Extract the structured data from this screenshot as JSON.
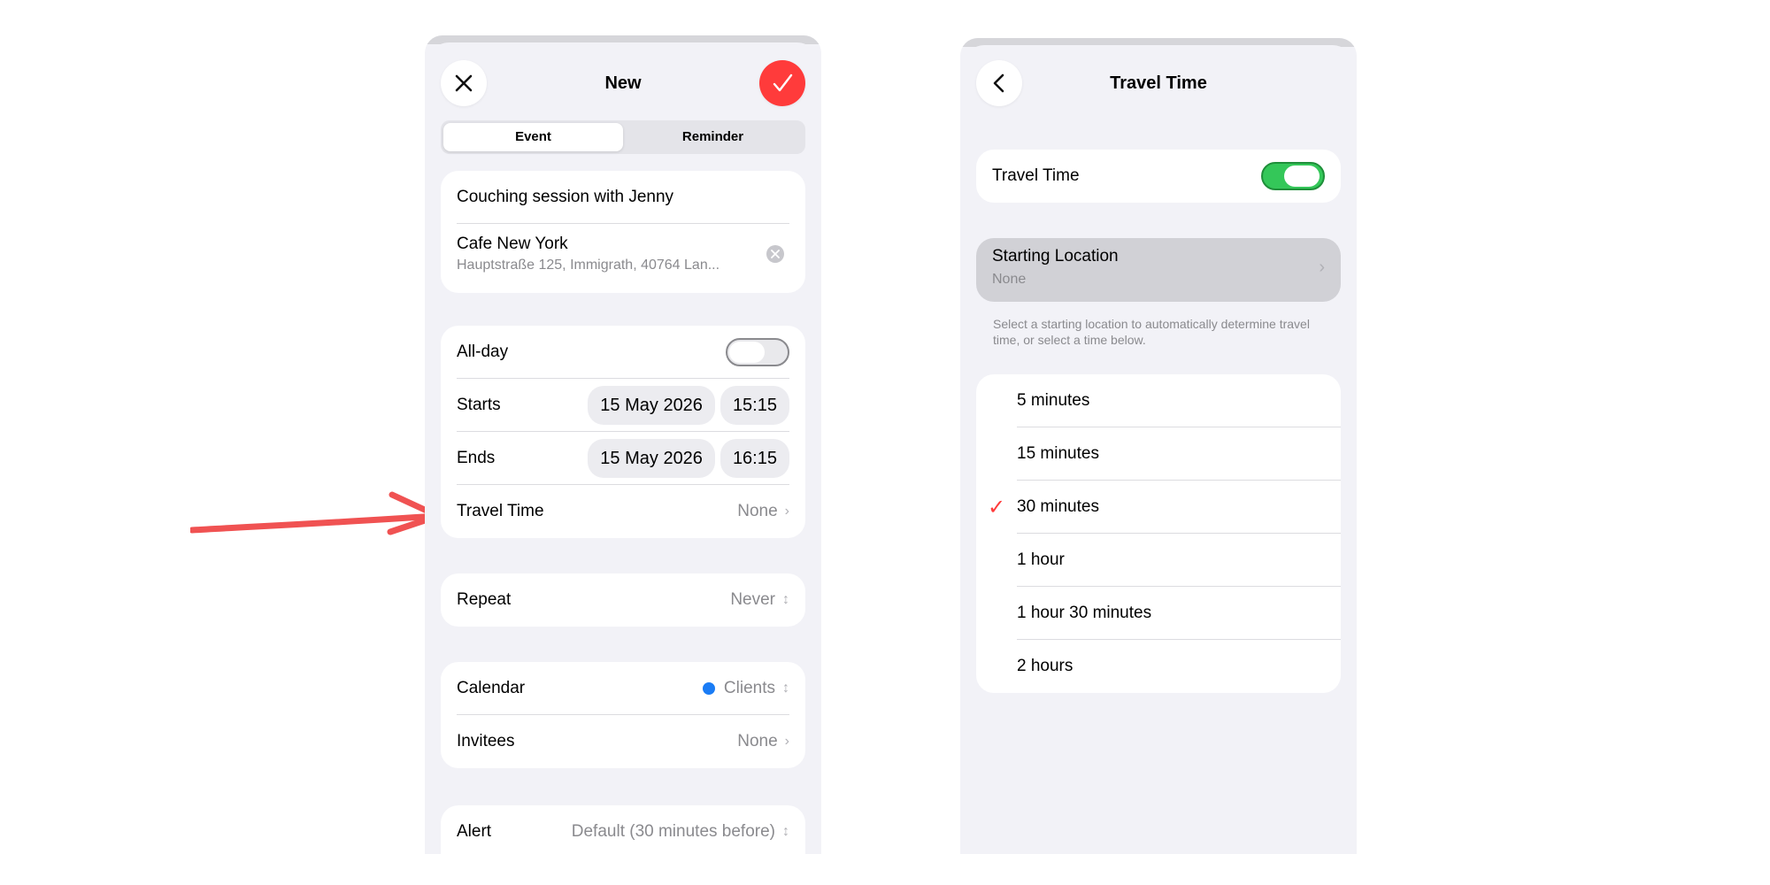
{
  "left": {
    "nav": {
      "title": "New"
    },
    "segments": [
      "Event",
      "Reminder"
    ],
    "event_title": "Couching session with Jenny",
    "location": {
      "name": "Cafe New York",
      "address": "Hauptstraße 125, Immigrath, 40764 Lan..."
    },
    "rows": {
      "allday": {
        "label": "All-day"
      },
      "starts": {
        "label": "Starts",
        "date": "15 May 2026",
        "time": "15:15"
      },
      "ends": {
        "label": "Ends",
        "date": "15 May 2026",
        "time": "16:15"
      },
      "travel": {
        "label": "Travel Time",
        "value": "None"
      },
      "repeat": {
        "label": "Repeat",
        "value": "Never"
      },
      "calendar": {
        "label": "Calendar",
        "value": "Clients"
      },
      "invitees": {
        "label": "Invitees",
        "value": "None"
      },
      "alert": {
        "label": "Alert",
        "value": "Default (30 minutes before)"
      }
    }
  },
  "right": {
    "nav": {
      "title": "Travel Time"
    },
    "toggle_label": "Travel Time",
    "starting_location": {
      "label": "Starting Location",
      "value": "None"
    },
    "hint": "Select a starting location to automatically determine travel time, or select a time below.",
    "options": [
      {
        "label": "5 minutes",
        "selected": false
      },
      {
        "label": "15 minutes",
        "selected": false
      },
      {
        "label": "30 minutes",
        "selected": true
      },
      {
        "label": "1 hour",
        "selected": false
      },
      {
        "label": "1 hour 30 minutes",
        "selected": false
      },
      {
        "label": "2 hours",
        "selected": false
      }
    ]
  },
  "colors": {
    "accent_red": "#ff3b3b",
    "toggle_green": "#34c759",
    "calendar_dot": "#1a7cf5",
    "arrow": "#f05252"
  },
  "icons": {
    "close": "close-icon",
    "confirm": "checkmark-icon",
    "back": "chevron-left-icon",
    "disclosure": "chevron-right-icon",
    "updown": "chevron-updown-icon"
  }
}
